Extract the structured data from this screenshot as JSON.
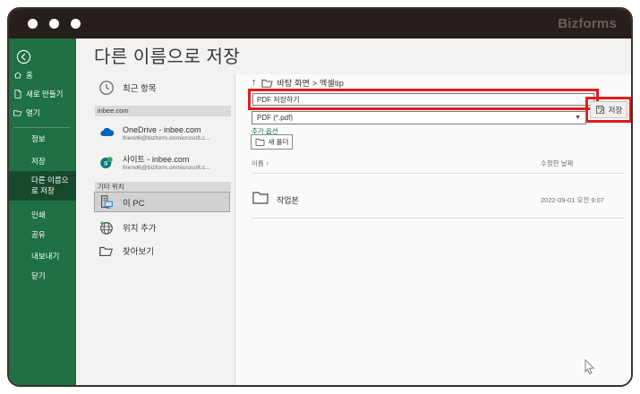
{
  "window": {
    "logo": "Bizforms"
  },
  "sidebar": {
    "nav": [
      {
        "label": "홈",
        "icon": "home-icon"
      },
      {
        "label": "새로 만들기",
        "icon": "new-document-icon"
      },
      {
        "label": "열기",
        "icon": "open-folder-icon"
      }
    ],
    "menu": [
      {
        "label": "정보",
        "selected": false
      },
      {
        "label": "저장",
        "selected": false
      },
      {
        "label": "다른 이름으로 저장",
        "selected": true
      },
      {
        "label": "인쇄",
        "selected": false
      },
      {
        "label": "공유",
        "selected": false
      },
      {
        "label": "내보내기",
        "selected": false
      },
      {
        "label": "닫기",
        "selected": false
      }
    ]
  },
  "page": {
    "title": "다른 이름으로 저장"
  },
  "places": {
    "recent": "최근 항목",
    "account_section": {
      "header": "inbee.com",
      "items": [
        {
          "title": "OneDrive - inbee.com",
          "subtitle": "friend6@bizform.onmicrosoft.c...",
          "icon": "onedrive-icon"
        },
        {
          "title": "사이트 - inbee.com",
          "subtitle": "friend6@bizform.onmicrosoft.c...",
          "icon": "sharepoint-icon"
        }
      ]
    },
    "other_section": {
      "header": "기타 위치",
      "items": [
        {
          "title": "이 PC",
          "icon": "this-pc-icon",
          "selected": true
        },
        {
          "title": "위치 추가",
          "icon": "add-place-globe-icon",
          "selected": false
        },
        {
          "title": "찾아보기",
          "icon": "browse-folder-icon",
          "selected": false
        }
      ]
    }
  },
  "save_panel": {
    "breadcrumb": {
      "up_arrow": "↑",
      "path": "바탕 화면 > 엑셀tip"
    },
    "filename": {
      "value": "PDF 저장하기"
    },
    "filetype": {
      "value": "PDF (*.pdf)",
      "caret": "▼"
    },
    "more_options_label": "추가 옵션",
    "save_button_label": "저장",
    "new_folder_label": "새 폴더",
    "list": {
      "columns": {
        "name": "이름",
        "sort_arrow": "↑",
        "modified": "수정한 날짜"
      },
      "rows": [
        {
          "name": "작업본",
          "modified": "2022-09-01 오전 9:07"
        }
      ]
    }
  },
  "colors": {
    "titlebar": "#261f1b",
    "sidebar_green": "#1f7044",
    "sidebar_selected_green": "#174a2c",
    "annotation_red": "#e01d1d",
    "link_green": "#1f7044",
    "onedrive_blue": "#0364b8",
    "sharepoint_teal": "#03787c"
  }
}
